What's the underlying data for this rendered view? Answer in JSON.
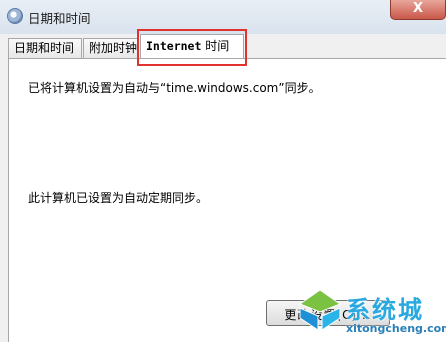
{
  "window": {
    "title": "日期和时间",
    "close_label": "X"
  },
  "tabs": {
    "date_time": "日期和时间",
    "additional_clocks": "附加时钟",
    "internet_time_en": "Internet",
    "internet_time_cn": "时间"
  },
  "content": {
    "sync_server_text": "已将计算机设置为自动与“time.windows.com”同步。",
    "scheduled_sync_text": "此计算机已设置为自动定期同步。"
  },
  "buttons": {
    "change_settings": "更改设置(C)..."
  },
  "watermark": {
    "name": "系统城",
    "url": "xitongcheng.com"
  },
  "colors": {
    "highlight_box": "#e0332e",
    "watermark_blue": "#2aa9e0"
  }
}
